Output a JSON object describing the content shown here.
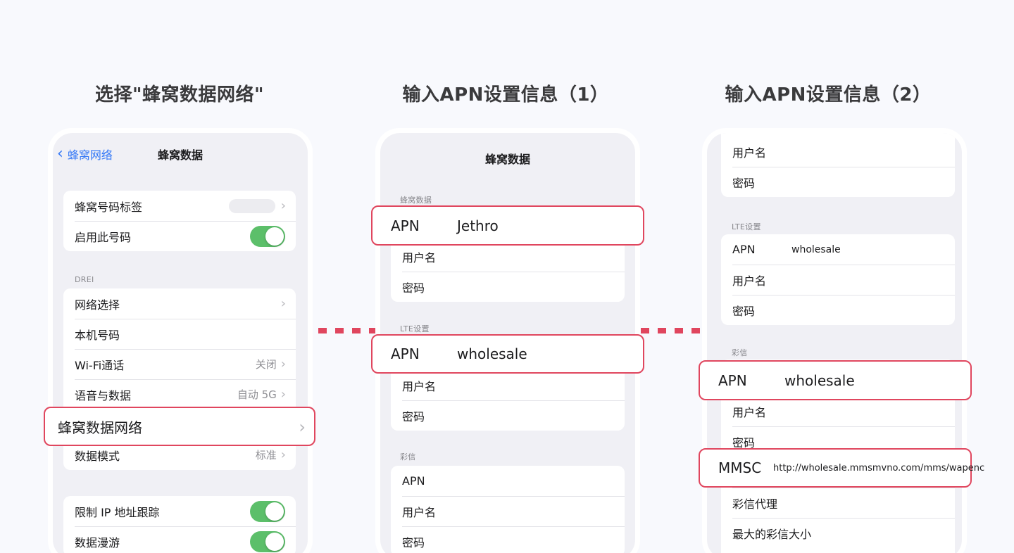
{
  "headings": {
    "step1": "选择\"蜂窝数据网络\"",
    "step2": "输入APN设置信息（1）",
    "step3": "输入APN设置信息（2）"
  },
  "phone1": {
    "back_label": "蜂窝网络",
    "title": "蜂窝数据",
    "group1": {
      "label_row": "蜂窝号码标签",
      "enable_row": "启用此号码"
    },
    "section_drei": "DREI",
    "group2": {
      "network_select": "网络选择",
      "my_number": "本机号码",
      "wifi_calling": "Wi-Fi通话",
      "wifi_calling_value": "关闭",
      "voice_data": "语音与数据",
      "voice_data_value": "自动 5G",
      "cellular_network": "蜂窝数据网络",
      "data_mode": "数据模式",
      "data_mode_value": "标准"
    },
    "group3": {
      "limit_ip": "限制 IP 地址跟踪",
      "data_roaming": "数据漫游"
    }
  },
  "phone2": {
    "title": "蜂窝数据",
    "section_cellular": "蜂窝数据",
    "apn_label": "APN",
    "apn_value": "Jethro",
    "username": "用户名",
    "password": "密码",
    "section_lte": "LTE设置",
    "lte_apn_label": "APN",
    "lte_apn_value": "wholesale",
    "lte_username": "用户名",
    "lte_password": "密码",
    "section_mms": "彩信",
    "mms_apn_label": "APN",
    "mms_username": "用户名",
    "mms_password": "密码"
  },
  "phone3": {
    "username": "用户名",
    "password": "密码",
    "section_lte": "LTE设置",
    "lte_apn_label": "APN",
    "lte_apn_value": "wholesale",
    "lte_username": "用户名",
    "lte_password": "密码",
    "section_mms": "彩信",
    "mms_apn_label": "APN",
    "mms_apn_value": "wholesale",
    "mms_username": "用户名",
    "mms_password": "密码",
    "mmsc_label": "MMSC",
    "mmsc_value": "http://wholesale.mmsmvno.com/mms/wapenc",
    "mms_proxy": "彩信代理",
    "mms_max_size": "最大的彩信大小"
  },
  "colors": {
    "highlight": "#e0465e",
    "toggle_on": "#5cbf6a",
    "link_blue": "#3478f6"
  },
  "icons": {
    "back": "chevron-left-icon",
    "disclosure": "chevron-right-icon",
    "toggle": "toggle-switch"
  }
}
